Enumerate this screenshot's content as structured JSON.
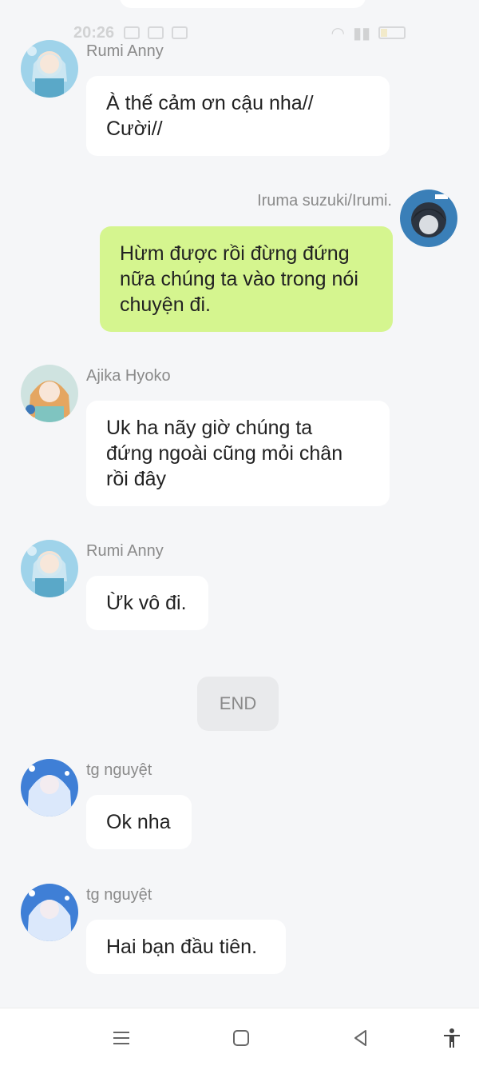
{
  "status_bar": {
    "time": "20:26"
  },
  "messages": [
    {
      "sender": "Rumi Anny",
      "lines": [
        "À thế cảm ơn cậu nha//",
        "Cười//"
      ],
      "side": "left"
    },
    {
      "sender": "Iruma suzuki/Irumi.",
      "lines": [
        "Hừm được rồi đừng đứng",
        "nữa chúng ta vào trong nói",
        "chuyện đi."
      ],
      "side": "right"
    },
    {
      "sender": "Ajika Hyoko",
      "lines": [
        "Uk ha nãy giờ chúng ta",
        "đứng ngoài cũng mỏi chân",
        "rồi đây"
      ],
      "side": "left"
    },
    {
      "sender": "Rumi Anny",
      "lines": [
        "Ừk vô đi."
      ],
      "side": "left"
    },
    {
      "sender": "tg nguyệt",
      "lines": [
        "Ok nha"
      ],
      "side": "left"
    },
    {
      "sender": "tg nguyệt",
      "lines": [
        "Hai bạn đầu tiên."
      ],
      "side": "left"
    }
  ],
  "divider": {
    "label": "END"
  },
  "nav_bar": {
    "icons": [
      "menu-icon",
      "home-square-icon",
      "back-triangle-icon",
      "accessibility-icon"
    ]
  },
  "colors": {
    "background": "#f5f6f8",
    "own_bubble": "#d5f58f",
    "other_bubble": "#ffffff",
    "sender_text": "#8a8a8a"
  }
}
